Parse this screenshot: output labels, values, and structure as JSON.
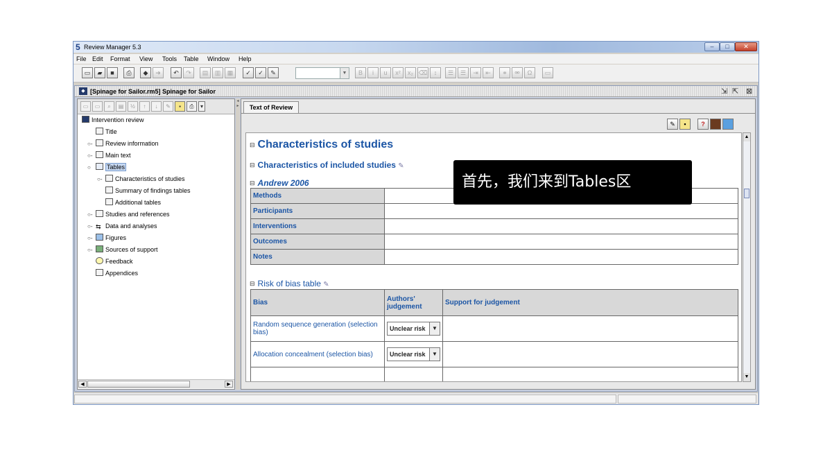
{
  "window": {
    "title": "Review Manager 5.3",
    "app_icon_glyph": "5"
  },
  "menu": [
    "File",
    "Edit",
    "Format",
    "View",
    "Tools",
    "Table",
    "Window",
    "Help"
  ],
  "document": {
    "title": "[Spinage for Sailor.rm5] Spinage for Sailor",
    "controls": [
      "restore-icon",
      "maximize-icon",
      "close-icon"
    ]
  },
  "tree": {
    "root": "Intervention review",
    "items": [
      {
        "label": "Title",
        "icon": "title-icon"
      },
      {
        "label": "Review information",
        "icon": "info-icon"
      },
      {
        "label": "Main text",
        "icon": "text-icon"
      },
      {
        "label": "Tables",
        "icon": "table-icon"
      },
      {
        "label": "Characteristics of studies",
        "icon": "table-icon"
      },
      {
        "label": "Summary of findings tables",
        "icon": "table-icon"
      },
      {
        "label": "Additional tables",
        "icon": "table-icon"
      },
      {
        "label": "Studies and references",
        "icon": "studies-icon"
      },
      {
        "label": "Data and analyses",
        "icon": "data-icon"
      },
      {
        "label": "Figures",
        "icon": "figure-icon"
      },
      {
        "label": "Sources of support",
        "icon": "support-icon"
      },
      {
        "label": "Feedback",
        "icon": "feedback-icon"
      },
      {
        "label": "Appendices",
        "icon": "appendix-icon"
      }
    ]
  },
  "right_pane": {
    "tab": "Text of Review",
    "h1": "Characteristics of studies",
    "h2": "Characteristics of included studies",
    "study": "Andrew 2006",
    "char_rows": [
      "Methods",
      "Participants",
      "Interventions",
      "Outcomes",
      "Notes"
    ],
    "bias_heading": "Risk of bias table",
    "bias_headers": [
      "Bias",
      "Authors' judgement",
      "Support for judgement"
    ],
    "bias_rows": [
      {
        "bias": "Random sequence generation (selection bias)",
        "judgement": "Unclear risk"
      },
      {
        "bias": "Allocation concealment (selection bias)",
        "judgement": "Unclear risk"
      }
    ]
  },
  "callout": "首先，我们来到Tables区",
  "colors": {
    "heading": "#1b55a5",
    "callout_bg": "#000000",
    "selected": "#c6d8f2"
  }
}
